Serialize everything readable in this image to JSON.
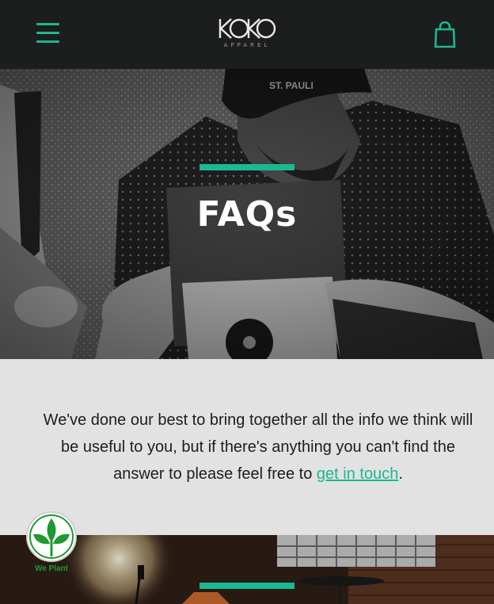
{
  "header": {
    "menu_icon": "hamburger-menu-icon",
    "logo_text": "KOKO",
    "logo_subtitle": "APPAREL",
    "cart_icon": "shopping-bag-icon"
  },
  "hero": {
    "title": "FAQs",
    "cap_text": "ST. PAULI"
  },
  "intro": {
    "text_before": "We've done our best to bring together all the info we think will be useful to you, but if there's anything you can't find the answer to please feel free to ",
    "link_text": "get in touch",
    "text_after": "."
  },
  "badge": {
    "label": "We Plant",
    "icon": "leaf-icon"
  },
  "colors": {
    "accent": "#1bb891",
    "header_bg": "#1c1d1d",
    "section_bg": "#e2e2e2",
    "badge_green": "#1f9a2f"
  }
}
